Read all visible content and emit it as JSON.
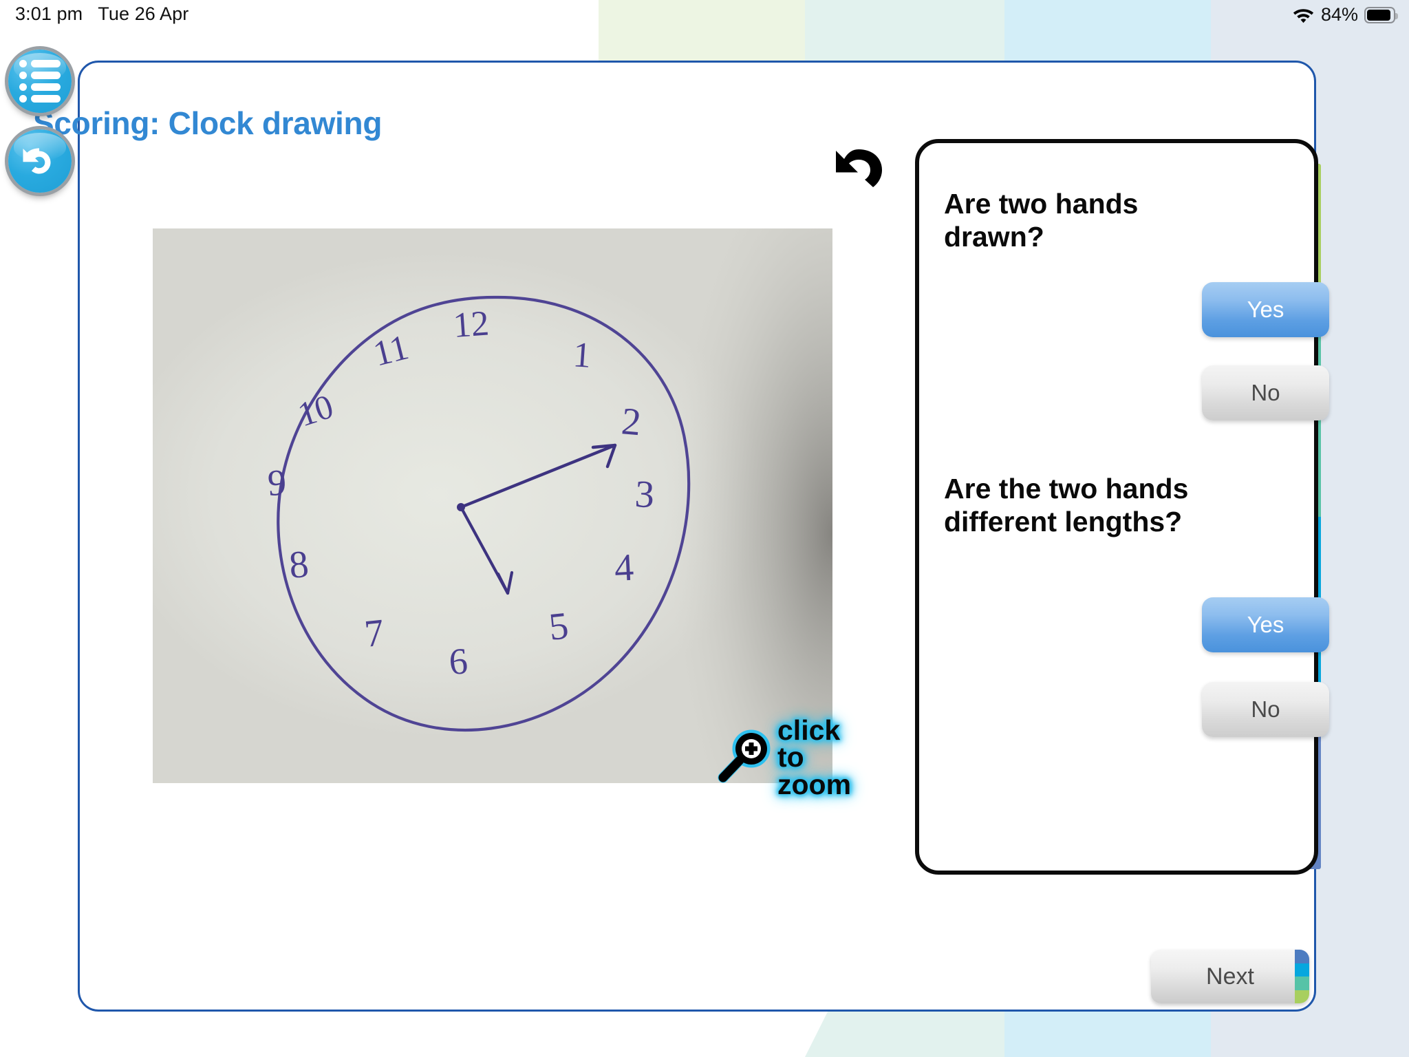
{
  "status_bar": {
    "time": "3:01 pm",
    "date": "Tue 26 Apr",
    "battery_percent": "84%",
    "wifi_icon": "wifi-icon",
    "battery_icon": "battery-icon",
    "battery_level": 84
  },
  "rail": {
    "menu_icon": "list-menu-icon",
    "undo_icon": "undo-arrow-icon"
  },
  "header": {
    "title": "Scoring: Clock drawing",
    "title_color": "#3288d3"
  },
  "rotate_hint": {
    "icon": "rotate-left-icon"
  },
  "clock_photo": {
    "alt": "hand-drawn clock face photograph",
    "numbers": [
      "12",
      "1",
      "2",
      "3",
      "4",
      "5",
      "6",
      "7",
      "8",
      "9",
      "10",
      "11"
    ],
    "ink_color": "#4a3f8f",
    "paper_color": "#e3e4de",
    "hands": [
      {
        "name": "long-hand",
        "points_to": "2"
      },
      {
        "name": "short-hand",
        "points_to": "between 5 and 6"
      }
    ],
    "zoom_badge": {
      "line1": "click to",
      "line2": "zoom",
      "icon": "magnifier-plus-icon",
      "glow_color": "#2fc0ee"
    }
  },
  "question_panel": {
    "questions": [
      {
        "text": "Are two hands drawn?",
        "answers": [
          {
            "label": "Yes",
            "state": "selected"
          },
          {
            "label": "No",
            "state": "unselected"
          }
        ]
      },
      {
        "text": "Are the two hands different lengths?",
        "answers": [
          {
            "label": "Yes",
            "state": "selected"
          },
          {
            "label": "No",
            "state": "unselected"
          }
        ]
      }
    ]
  },
  "spectrum_strip": {
    "segments": [
      {
        "color": "#a8cf5f",
        "height_pct": 19
      },
      {
        "color": "#57c3a6",
        "height_pct": 31
      },
      {
        "color": "#05a6dd",
        "height_pct": 24
      },
      {
        "color": "#6384c4",
        "height_pct": 26
      }
    ]
  },
  "footer": {
    "next_label": "Next",
    "next_strip_colors": [
      "#4d7cc1",
      "#06a7de",
      "#56c3a7",
      "#a8cf5f"
    ]
  },
  "background": {
    "band_colors": [
      "#edf5e3",
      "#e2f2ee",
      "#d3eef8",
      "#e2e9f1"
    ],
    "card_border_color": "#1f57ab"
  }
}
